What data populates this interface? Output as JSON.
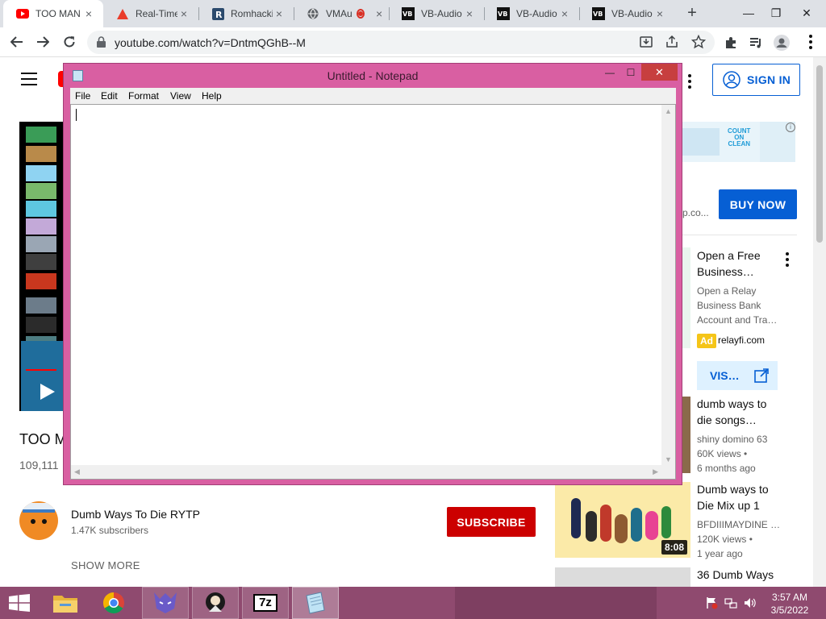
{
  "browser": {
    "tabs": [
      {
        "title": "TOO MAN",
        "icon": "youtube-icon",
        "active": true
      },
      {
        "title": "Real-Time",
        "icon": "warning-triangle-icon",
        "active": false
      },
      {
        "title": "Romhacki",
        "icon": "romhacking-icon",
        "active": false
      },
      {
        "title": "VMAu",
        "icon": "globe-icon",
        "active": false,
        "recording": true
      },
      {
        "title": "VB-Audio",
        "icon": "vb-audio-icon",
        "active": false
      },
      {
        "title": "VB-Audio",
        "icon": "vb-audio-icon",
        "active": false
      },
      {
        "title": "VB-Audio",
        "icon": "vb-audio-icon",
        "active": false
      }
    ],
    "tab_close": "×",
    "new_tab": "+",
    "window_controls": {
      "minimize": "—",
      "maximize": "❐",
      "close": "✕"
    },
    "url": "youtube.com/watch?v=DntmQGhB--M"
  },
  "youtube": {
    "sign_in": "SIGN IN",
    "video_title": "TOO M",
    "views": "109,111",
    "channel": {
      "name": "Dumb Ways To Die RYTP",
      "subscribers": "1.47K subscribers"
    },
    "subscribe": "SUBSCRIBE",
    "show_more": "SHOW MORE",
    "ad": {
      "banner_text": [
        "COUNT",
        "ON",
        "CLEAN"
      ],
      "domain_partial": "p.co...",
      "buy_now": "BUY NOW"
    },
    "sponsored": {
      "title_1": "Open a Free",
      "title_2": "Business…",
      "desc_1": "Open a Relay",
      "desc_2": "Business Bank",
      "desc_3": "Account and Tra…",
      "badge": "Ad",
      "domain": "relayfi.com",
      "visit": "VIS…"
    },
    "recommended": [
      {
        "title_1": "dumb ways to",
        "title_2": "die songs…",
        "channel": "shiny domino 63",
        "views": "60K views •",
        "age": "6 months ago"
      },
      {
        "title_1": "Dumb ways to",
        "title_2": "Die Mix up 1",
        "channel": "BFDIIIMAYDINE …",
        "views": "120K views •",
        "age": "1 year ago",
        "duration": "8:08"
      },
      {
        "title_1": "36 Dumb Ways"
      }
    ]
  },
  "notepad": {
    "title": "Untitled - Notepad",
    "menu": [
      "File",
      "Edit",
      "Format",
      "View",
      "Help"
    ],
    "controls": {
      "minimize": "—",
      "maximize": "☐",
      "close": "✕"
    },
    "content": ""
  },
  "taskbar": {
    "apps": [
      "file-explorer",
      "chrome",
      "game-app",
      "avatar-app",
      "7-zip",
      "notepad"
    ],
    "seven_zip_label": "7z",
    "time": "3:57 AM",
    "date": "3/5/2022"
  },
  "colors": {
    "notepad_frame": "#d95fa2",
    "taskbar": "#8f4a6f",
    "youtube_red": "#ff0000",
    "subscribe_red": "#cc0000",
    "link_blue": "#065fd4"
  }
}
